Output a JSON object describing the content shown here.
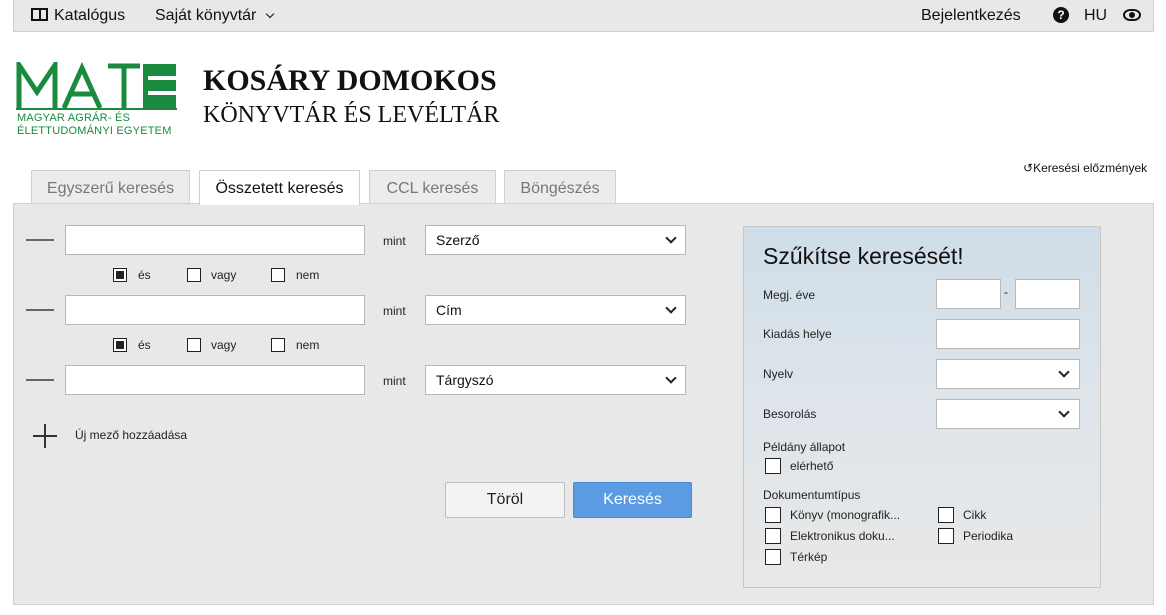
{
  "topbar": {
    "catalog": "Katalógus",
    "my_library": "Saját könyvtár",
    "login": "Bejelentkezés",
    "help": "?",
    "language": "HU"
  },
  "logo": {
    "word": "MATE",
    "line1": "MAGYAR AGRÁR- ÉS",
    "line2": "ÉLETTUDOMÁNYI EGYETEM",
    "color": "#1a8a3f"
  },
  "header": {
    "title": "KOSÁRY DOMOKOS",
    "subtitle": "KÖNYVTÁR ÉS LEVÉLTÁR"
  },
  "history_link": "Keresési előzmények",
  "tabs": [
    {
      "label": "Egyszerű keresés",
      "active": false
    },
    {
      "label": "Összetett keresés",
      "active": true
    },
    {
      "label": "CCL keresés",
      "active": false
    },
    {
      "label": "Böngészés",
      "active": false
    }
  ],
  "rows": [
    {
      "value": "",
      "as_label": "mint",
      "field": "Szerző"
    },
    {
      "value": "",
      "as_label": "mint",
      "field": "Cím"
    },
    {
      "value": "",
      "as_label": "mint",
      "field": "Tárgyszó"
    }
  ],
  "operators": [
    "és",
    "vagy",
    "nem"
  ],
  "operator_selected": "és",
  "add_field": "Új mező hozzáadása",
  "buttons": {
    "clear": "Töröl",
    "search": "Keresés"
  },
  "refine": {
    "title": "Szűkítse keresését!",
    "year_label": "Megj. éve",
    "year_separator": "-",
    "year_from": "",
    "year_to": "",
    "place_label": "Kiadás helye",
    "place_value": "",
    "language_label": "Nyelv",
    "language_value": "",
    "class_label": "Besorolás",
    "class_value": "",
    "copy_status_label": "Példány állapot",
    "copy_status_option": "elérhető",
    "doctype_label": "Dokumentumtípus",
    "doctypes": [
      "Könyv (monografik...",
      "Cikk",
      "Elektronikus doku...",
      "Periodika",
      "Térkép"
    ]
  },
  "colors": {
    "accent": "#5a9be4",
    "brand": "#1a8a3f"
  }
}
